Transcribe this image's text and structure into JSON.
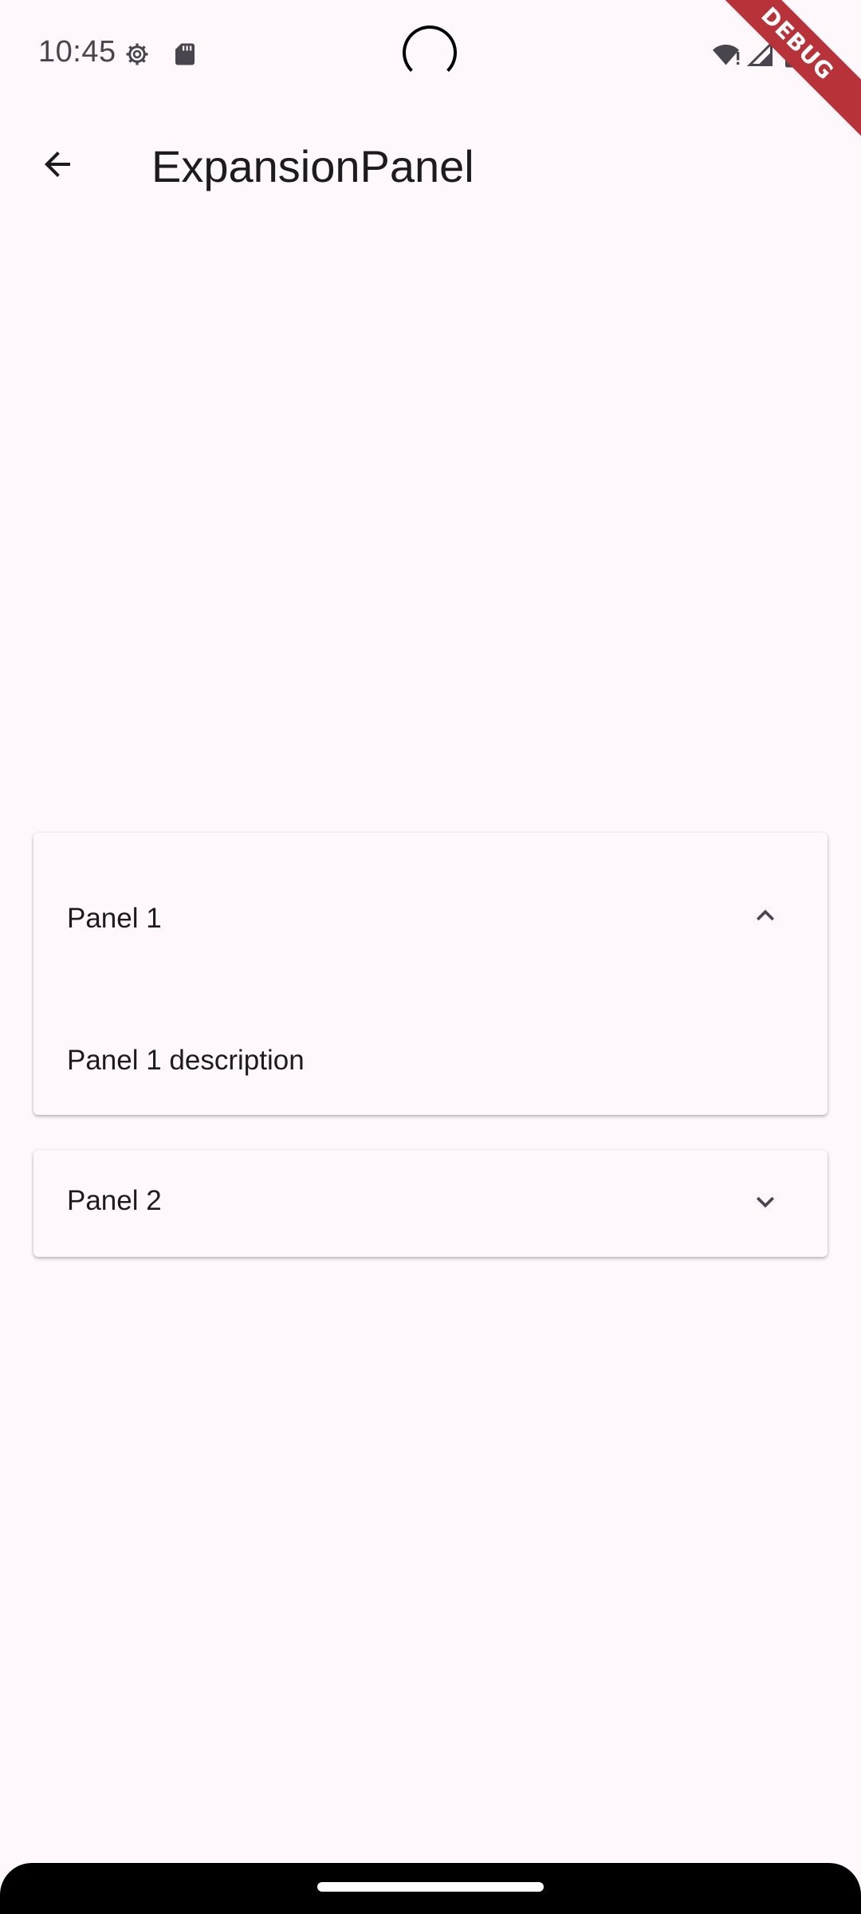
{
  "status_bar": {
    "time": "10:45",
    "left_icons": [
      "settings-gear-icon",
      "sd-card-icon"
    ],
    "right_icons": [
      "wifi-alert-icon",
      "signal-icon",
      "battery-icon"
    ],
    "debug_label": "DEBUG"
  },
  "app_bar": {
    "back_icon": "arrow-back-icon",
    "title": "ExpansionPanel"
  },
  "panels": [
    {
      "header": "Panel 1",
      "expanded": true,
      "body": "Panel 1 description",
      "icon": "chevron-up-icon"
    },
    {
      "header": "Panel 2",
      "expanded": false,
      "icon": "chevron-down-icon"
    }
  ],
  "colors": {
    "background": "#fef7fb",
    "text": "#1d1b20",
    "icon_muted": "#49454f",
    "debug_banner": "#b8323a"
  }
}
